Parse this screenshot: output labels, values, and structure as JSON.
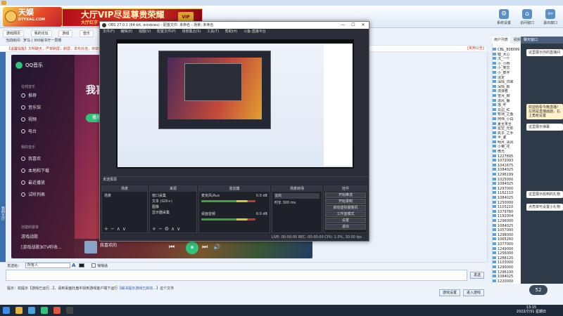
{
  "app": {
    "logo_text": "天娱",
    "logo_sub": "DTYXAG.COM",
    "vip_banner": "大厅VIP尽显尊贵荣耀",
    "vip_sub": "大厅红字",
    "vip_badge": "VIP",
    "header_buttons": [
      {
        "label": "系统设置",
        "glyph": "⚙"
      },
      {
        "label": "访问窗口",
        "glyph": "⌂"
      },
      {
        "label": "退出窗口",
        "glyph": "⇦"
      }
    ]
  },
  "menurow": [
    "游戏网页",
    "我的论坛",
    "游戏",
    "音乐"
  ],
  "room_info": "当前房间：罗马 | 300秘书厅一层楼",
  "notice": "【温馨提醒】文明聊天，严禁刷屏，刷屏、发布外挂，将做封号处理！",
  "notice_right": "[常用公告]",
  "left_strip_label": "我的大厅",
  "qqmusic": {
    "brand": "QQ音乐",
    "sections": [
      "在线音乐",
      "我的音乐",
      "创建的歌单"
    ],
    "items_online": [
      "推荐",
      "音乐馆",
      "视频",
      "电台"
    ],
    "items_mine": [
      "我喜欢",
      "本地和下载",
      "最近播放",
      "试听列表"
    ],
    "playlists": [
      "游戏战歌",
      "[游戏战歌]KTV听收..."
    ],
    "title": "我喜",
    "play_label": "播放",
    "song": "我喜欢的",
    "controls": {
      "prev": "⏮",
      "play": "⏸",
      "next": "⏭",
      "volume": "🔊"
    }
  },
  "obs": {
    "title": "OBS 27.0.1 (64-bit, windows) - 配置文件: 未命名 - 场景: 未命名",
    "menu": [
      "文件(F)",
      "编辑(E)",
      "视图(V)",
      "配置文件(P)",
      "场景集合(S)",
      "工具(T)",
      "帮助(H)",
      "斗鱼-直播平台"
    ],
    "scene_bar": "未选择源",
    "docks": {
      "scenes": {
        "title": "场景",
        "items": [
          "场景"
        ]
      },
      "sources": {
        "title": "来源",
        "items": [
          "窗口采集",
          "文本 (GDI+)",
          "图像",
          "显示器采集"
        ]
      },
      "mixer": {
        "title": "混音器",
        "tracks": [
          {
            "name": "麦克风/Aux",
            "db": "0.0 dB"
          },
          {
            "name": "桌面音频",
            "db": "0.0 dB"
          }
        ]
      },
      "transitions": {
        "title": "场景转场",
        "type": "淡出",
        "duration_label": "时长",
        "duration": "300 ms"
      },
      "controls": {
        "title": "控件",
        "buttons": [
          "开始推流",
          "开始录制",
          "启动虚拟摄像机",
          "工作室模式",
          "设置",
          "退出"
        ]
      }
    },
    "status": "LIVE: 00:00:00   REC: 00:00:00   CPU: 1.0%, 30.00 fps"
  },
  "users": {
    "tabs": [
      "用户列表",
      "视频窗口",
      "好友"
    ],
    "list": [
      "CBL_808099",
      "嘘_大心",
      "沉_一个",
      "小_小桥",
      "小_笑忘",
      "小_数字",
      "淡定",
      "深情_归来",
      "深情_颜",
      "流浪者",
      "雪月_柳",
      "追风_静",
      "落_叶",
      "云边_红",
      "牧场_之鱼",
      "阿伟_小白",
      "夏至未至",
      "星空_光影",
      "执子_之手",
      "半_夏",
      "明月_清风",
      "小菊_花",
      "微光",
      "1227895",
      "1072093",
      "1041675",
      "1084025",
      "1296199",
      "1025000",
      "1084025",
      "1297000",
      "1162110",
      "1084025",
      "1250000",
      "1103210",
      "1079780",
      "1192004",
      "1296000",
      "1084025",
      "1057000",
      "1298000",
      "1065260",
      "1077000",
      "1249000",
      "1256000",
      "1288120",
      "1103000",
      "1290000",
      "1296100",
      "1084025",
      "1220000",
      "1290000",
      "1103000",
      "1104200",
      "1029000",
      "1045000",
      "1103000",
      "1066000",
      "1200000"
    ]
  },
  "chat": {
    "header": "聊天窗口",
    "bubbles": [
      "这里展示你的直播间",
      "欢迎收看今晚直播！左侧是直播画面，右上角有设置",
      "这里展示弹幕",
      "这里展示收到的礼物",
      "点亮单可设置小礼物"
    ]
  },
  "compose": {
    "send_to_label": "发送给：",
    "send_to_value": "所有人",
    "font_icon": "A",
    "private_label": "悄悄话",
    "send_button": "发送"
  },
  "tip": {
    "prefix": "提示：",
    "body": "如提示【游戏已运行...】，请到桌面托盘中找到游戏客户端下运行",
    "link": "【解决提示游戏已启动...】",
    "suffix": "这个文件"
  },
  "bottom_buttons": {
    "game_settings": "游戏设置",
    "enter_game": "进入游戏"
  },
  "float_widget": "52",
  "clock": {
    "time": "13:15",
    "date": "2022/7/31 星期日"
  }
}
